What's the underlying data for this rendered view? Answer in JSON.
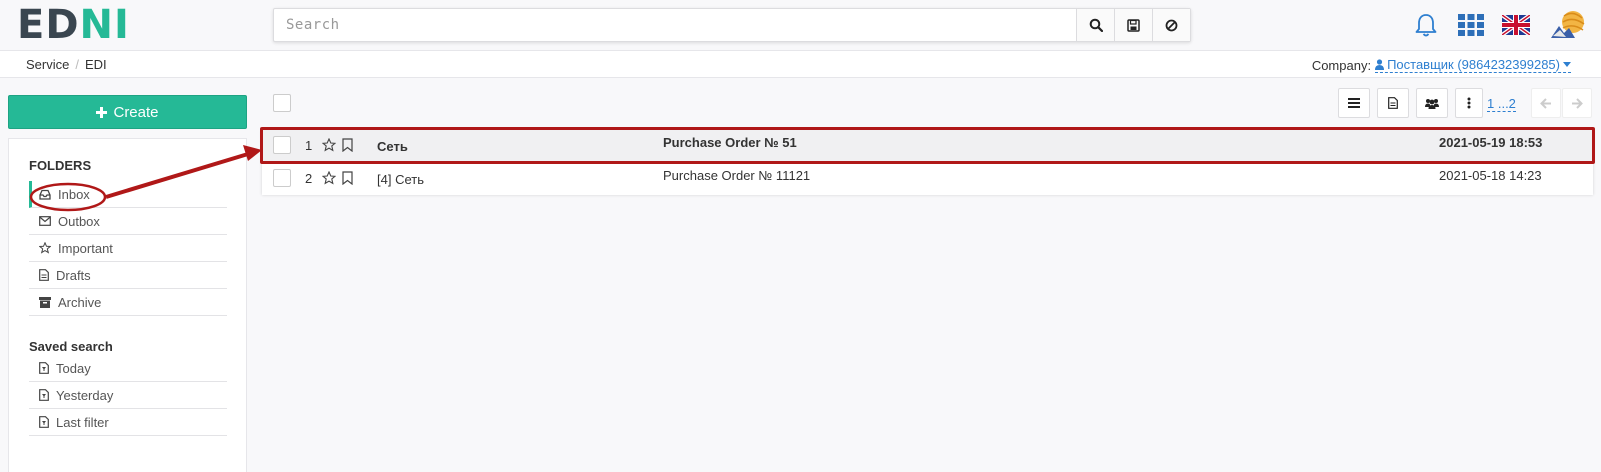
{
  "app": {
    "logo_part1": "ED",
    "logo_part2": "NI",
    "accent_color": "#25b996",
    "link_color": "#2e7fd0",
    "highlight_color": "#b01818"
  },
  "search": {
    "placeholder": "Search",
    "buttons": [
      "search-icon",
      "save-icon",
      "ban-icon"
    ]
  },
  "header_icons": [
    "bell-icon",
    "apps-grid-icon",
    "uk-flag-icon",
    "avatar"
  ],
  "breadcrumb": {
    "items": [
      "Service",
      "EDI"
    ],
    "separator": "/"
  },
  "company": {
    "label": "Company:",
    "value": "Поставщик (9864232399285)"
  },
  "sidebar": {
    "create_label": "Create",
    "folders_title": "FOLDERS",
    "folders": [
      {
        "label": "Inbox",
        "icon": "inbox-icon",
        "active": true
      },
      {
        "label": "Outbox",
        "icon": "envelope-icon"
      },
      {
        "label": "Important",
        "icon": "star-icon"
      },
      {
        "label": "Drafts",
        "icon": "file-icon"
      },
      {
        "label": "Archive",
        "icon": "archive-icon"
      }
    ],
    "saved_title": "Saved search",
    "saved": [
      {
        "label": "Today",
        "icon": "file-filter-icon"
      },
      {
        "label": "Yesterday",
        "icon": "file-filter-icon"
      },
      {
        "label": "Last filter",
        "icon": "file-filter-icon"
      }
    ]
  },
  "toolbar": {
    "buttons": [
      "list-icon",
      "document-icon",
      "users-icon",
      "more-vertical-icon"
    ],
    "pager": "1 ...2",
    "nav": [
      "prev-arrow-icon",
      "next-arrow-icon"
    ]
  },
  "messages": [
    {
      "num": "1",
      "sender": "Сеть",
      "subject": "Purchase Order № 51",
      "date": "2021-05-19 18:53",
      "unread": true
    },
    {
      "num": "2",
      "sender": "[4] Сеть",
      "subject": "Purchase Order № 11121",
      "date": "2021-05-18 14:23",
      "unread": false
    }
  ]
}
